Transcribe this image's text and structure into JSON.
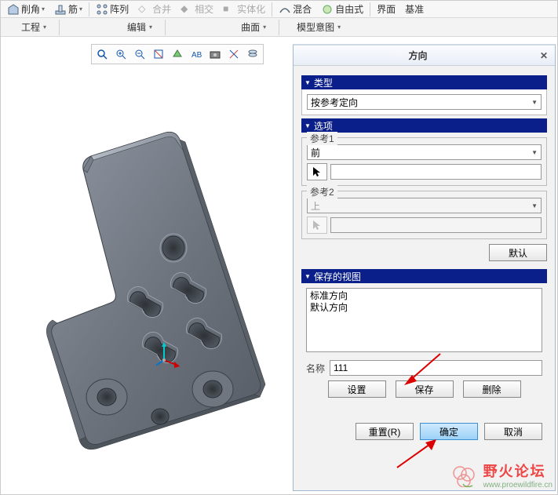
{
  "ribbon": {
    "items": [
      {
        "label": "削角",
        "icon": "chamfer-icon"
      },
      {
        "label": "",
        "icon": "rib-icon"
      },
      {
        "label": "筋",
        "icon": ""
      },
      {
        "label": "阵列",
        "icon": "pattern-icon"
      },
      {
        "label": "合并",
        "disabled": true
      },
      {
        "label": "相交",
        "disabled": true
      },
      {
        "label": "实体化",
        "disabled": true
      },
      {
        "label": "混合",
        "icon": "blend-icon"
      },
      {
        "label": "自由式",
        "icon": "freestyle-icon"
      },
      {
        "label": "界面",
        "icon": ""
      },
      {
        "label": "基准",
        "icon": ""
      }
    ]
  },
  "menus": {
    "engineering": "工程",
    "edit": "编辑",
    "surface": "曲面",
    "model_intent": "模型意图"
  },
  "dialog": {
    "title": "方向",
    "type_hdr": "类型",
    "type_value": "按参考定向",
    "options_hdr": "选项",
    "ref1_label": "参考1",
    "ref1_value": "前",
    "ref2_label": "参考2",
    "ref2_value": "上",
    "default_btn": "默认",
    "saved_views_hdr": "保存的视图",
    "saved_views": [
      "标准方向",
      "默认方向"
    ],
    "name_label": "名称",
    "name_value": "111",
    "set_btn": "设置",
    "save_btn": "保存",
    "delete_btn": "删除",
    "reset_btn": "重置(R)",
    "ok_btn": "确定",
    "cancel_btn": "取消"
  },
  "watermark": {
    "cn": "野火论坛",
    "en": "www.proewildfire.cn"
  }
}
